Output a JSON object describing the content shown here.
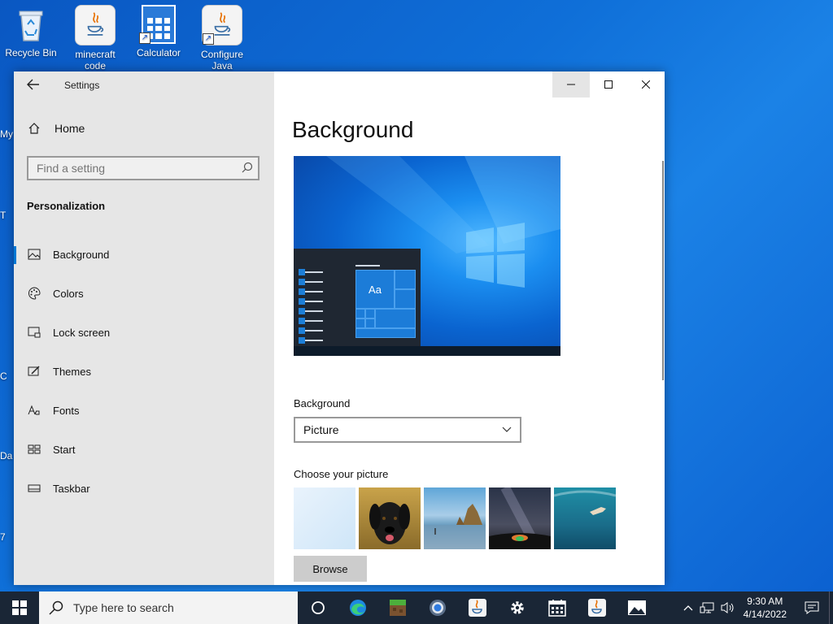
{
  "desktop": {
    "icons": [
      {
        "label": "Recycle Bin"
      },
      {
        "label": "minecraft code"
      },
      {
        "label": "Calculator"
      },
      {
        "label": "Configure Java"
      }
    ],
    "edge_fragments": [
      "My",
      "T",
      "C",
      "Da",
      "7"
    ]
  },
  "settings": {
    "app_title": "Settings",
    "home_label": "Home",
    "search_placeholder": "Find a setting",
    "section_label": "Personalization",
    "nav_items": [
      {
        "label": "Background",
        "icon": "picture-icon",
        "active": true
      },
      {
        "label": "Colors",
        "icon": "palette-icon"
      },
      {
        "label": "Lock screen",
        "icon": "lock-screen-icon"
      },
      {
        "label": "Themes",
        "icon": "themes-icon"
      },
      {
        "label": "Fonts",
        "icon": "fonts-icon"
      },
      {
        "label": "Start",
        "icon": "start-icon"
      },
      {
        "label": "Taskbar",
        "icon": "taskbar-icon"
      }
    ],
    "page_title": "Background",
    "preview_tile_text": "Aa",
    "background_label": "Background",
    "background_value": "Picture",
    "choose_picture_label": "Choose your picture",
    "browse_label": "Browse",
    "accent_color": "#0078d4"
  },
  "taskbar": {
    "search_placeholder": "Type here to search",
    "apps": [
      "task-view",
      "edge",
      "minecraft",
      "chrome",
      "java",
      "settings",
      "calendar",
      "java",
      "photos"
    ],
    "time": "9:30 AM",
    "date": "4/14/2022"
  }
}
